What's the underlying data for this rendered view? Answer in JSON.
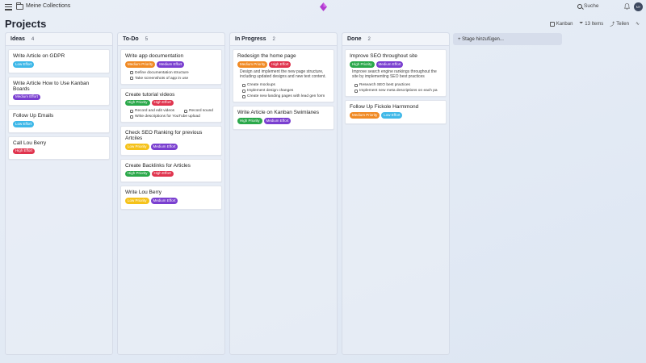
{
  "header": {
    "breadcrumb": "Meine Collections",
    "search_label": "Suche",
    "avatar_initials": "NY"
  },
  "page": {
    "title": "Projects"
  },
  "toolbar": {
    "kanban_label": "Kanban",
    "items_label": "13 Items",
    "share_label": "Teilen"
  },
  "stage_button_label": "+ Stage hinzufügen...",
  "colors": {
    "Low Effort": "#3fb8e8",
    "Medium Effort": "#7a3fd0",
    "High Effort": "#e0344e",
    "Medium Priority": "#f08a24",
    "High Priority": "#2aa84a",
    "Low Priority": "#f5c21a"
  },
  "columns": [
    {
      "name": "Ideas",
      "count": "4",
      "cards": [
        {
          "title": "Write Article on GDPR",
          "tags": [
            "Low Effort"
          ]
        },
        {
          "title": "Write Article How to Use Kanban Boards",
          "tags": [
            "Medium Effort"
          ]
        },
        {
          "title": "Follow Up Emails",
          "tags": [
            "Low Effort"
          ]
        },
        {
          "title": "Call Lou Berry",
          "tags": [
            "High Effort"
          ]
        }
      ]
    },
    {
      "name": "To-Do",
      "count": "5",
      "cards": [
        {
          "title": "Write app documentation",
          "tags": [
            "Medium Priority",
            "Medium Effort"
          ],
          "subtasks": [
            [
              "Define documentation structure"
            ],
            [
              "Take screenshots of app in use"
            ]
          ]
        },
        {
          "title": "Create tutorial videos",
          "tags": [
            "High Priority",
            "High Effort"
          ],
          "subtasks": [
            [
              "Record and edit videos",
              "Record sound"
            ],
            [
              "Write descriptions for YouTube upload"
            ]
          ]
        },
        {
          "title": "Check SEO Ranking for previous Artciles",
          "tags": [
            "Low Priority",
            "Medium Effort"
          ]
        },
        {
          "title": "Create Backlinks for Articles",
          "tags": [
            "High Priority",
            "High Effort"
          ]
        },
        {
          "title": "Write Lou Berry",
          "tags": [
            "Low Priority",
            "Medium Effort"
          ]
        }
      ]
    },
    {
      "name": "In Progress",
      "count": "2",
      "cards": [
        {
          "title": "Redesign the home page",
          "tags": [
            "Medium Priority",
            "High Effort"
          ],
          "description": "Design and implement the new page structure, including updated designs and new text content.",
          "subtasks": [
            [
              "Create mockups"
            ],
            [
              "Implement design changes"
            ],
            [
              "Create new landing pages with lead gen form"
            ]
          ]
        },
        {
          "title": "Write Article on Kanban Swimlanes",
          "tags": [
            "High Priority",
            "Medium Effort"
          ]
        }
      ]
    },
    {
      "name": "Done",
      "count": "2",
      "cards": [
        {
          "title": "Improve SEO throughout site",
          "tags": [
            "High Priority",
            "Medium Effort"
          ],
          "description": "Improve search engine rankings throughout the site by implementing SEO best practices",
          "subtasks": [
            [
              "Research SEO best practices"
            ],
            [
              "Implement new meta descriptions on each pa"
            ]
          ]
        },
        {
          "title": "Follow Up Fickole Harmmond",
          "tags": [
            "Medium Priority",
            "Low Effort"
          ]
        }
      ]
    }
  ]
}
